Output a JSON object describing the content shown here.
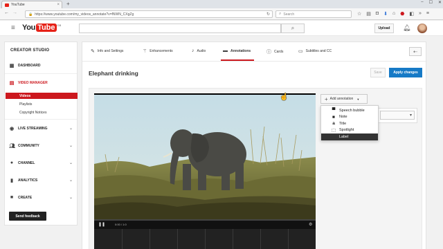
{
  "browser": {
    "tab_title": "YouTube",
    "url": "https://www.youtube.com/my_videos_annotate?v=fNWN_CXgZg",
    "search_placeholder": "Search"
  },
  "youtube": {
    "logo_text_you": "You",
    "logo_text_tube": "Tube",
    "logo_superscript": "GB",
    "upload_label": "Upload"
  },
  "sidebar": {
    "title": "CREATOR STUDIO",
    "items": [
      {
        "label": "DASHBOARD",
        "icon": "dashboard-icon"
      },
      {
        "label": "VIDEO MANAGER",
        "icon": "video-manager-icon"
      },
      {
        "label": "LIVE STREAMING",
        "icon": "live-streaming-icon"
      },
      {
        "label": "COMMUNITY",
        "icon": "community-icon"
      },
      {
        "label": "CHANNEL",
        "icon": "channel-icon"
      },
      {
        "label": "ANALYTICS",
        "icon": "analytics-icon"
      },
      {
        "label": "CREATE",
        "icon": "create-icon"
      }
    ],
    "video_manager_subitems": [
      "Videos",
      "Playlists",
      "Copyright Notices"
    ],
    "feedback_label": "Send feedback"
  },
  "editor": {
    "tabs": [
      {
        "label": "Info and Settings"
      },
      {
        "label": "Enhancements"
      },
      {
        "label": "Audio"
      },
      {
        "label": "Annotations"
      },
      {
        "label": "Cards"
      },
      {
        "label": "Subtitles and CC"
      }
    ],
    "active_tab": "Annotations",
    "video_title": "Elephant drinking",
    "save_label": "Save",
    "apply_label": "Apply changes",
    "time_display": "0:00 / 1:0",
    "add_annotation_label": "Add annotation",
    "annotation_types": [
      {
        "label": "Speech bubble",
        "icon": "speech-bubble-icon"
      },
      {
        "label": "Note",
        "icon": "note-icon"
      },
      {
        "label": "Title",
        "icon": "title-icon"
      },
      {
        "label": "Spotlight",
        "icon": "spotlight-icon"
      },
      {
        "label": "Label",
        "icon": "label-icon"
      }
    ],
    "selected_annotation_type": "Label"
  },
  "colors": {
    "youtube_red": "#cc181e",
    "apply_blue": "#167ac6"
  }
}
